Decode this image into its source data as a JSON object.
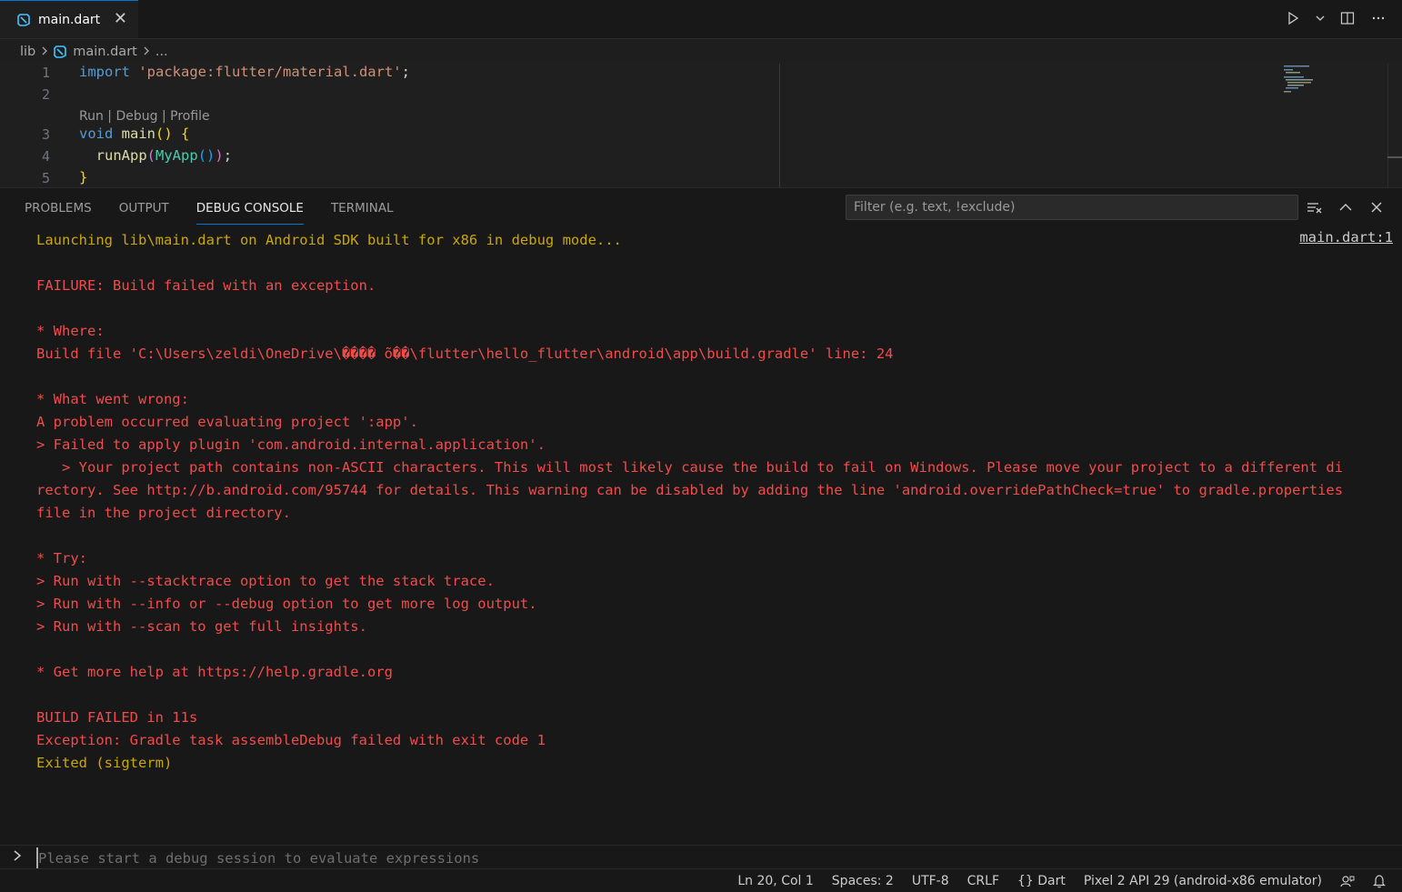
{
  "tab": {
    "label": "main.dart",
    "close": "✕"
  },
  "breadcrumb": {
    "folder": "lib",
    "file": "main.dart",
    "more": "..."
  },
  "editor": {
    "line_numbers": [
      "1",
      "2",
      "3",
      "4",
      "5"
    ],
    "codelens": "Run | Debug | Profile",
    "code": {
      "l1_kw": "import",
      "l1_str": "'package:flutter/material.dart'",
      "l1_end": ";",
      "l3_kw": "void",
      "l3_fn": "main",
      "l3_parens": "()",
      "l3_brace": "{",
      "l4_fn": "runApp",
      "l4_open": "(",
      "l4_cls": "MyApp",
      "l4_call": "()",
      "l4_close": ")",
      "l4_end": ";",
      "l5_brace": "}"
    }
  },
  "panel": {
    "tabs": [
      "PROBLEMS",
      "OUTPUT",
      "DEBUG CONSOLE",
      "TERMINAL"
    ],
    "active_tab": "DEBUG CONSOLE",
    "filter_placeholder": "Filter (e.g. text, !exclude)",
    "source_link": "main.dart:1",
    "console_lines": [
      {
        "text": "Launching lib\\main.dart on Android SDK built for x86 in debug mode...",
        "color": "yellow"
      },
      {
        "text": "",
        "color": "red"
      },
      {
        "text": "FAILURE: Build failed with an exception.",
        "color": "red"
      },
      {
        "text": "",
        "color": "red"
      },
      {
        "text": "* Where:",
        "color": "red"
      },
      {
        "text": "Build file 'C:\\Users\\zeldi\\OneDrive\\���� õ��\\flutter\\hello_flutter\\android\\app\\build.gradle' line: 24",
        "color": "red"
      },
      {
        "text": "",
        "color": "red"
      },
      {
        "text": "* What went wrong:",
        "color": "red"
      },
      {
        "text": "A problem occurred evaluating project ':app'.",
        "color": "red"
      },
      {
        "text": "> Failed to apply plugin 'com.android.internal.application'.",
        "color": "red"
      },
      {
        "text": "   > Your project path contains non-ASCII characters. This will most likely cause the build to fail on Windows. Please move your project to a different di",
        "color": "red"
      },
      {
        "text": "rectory. See http://b.android.com/95744 for details. This warning can be disabled by adding the line 'android.overridePathCheck=true' to gradle.properties",
        "color": "red"
      },
      {
        "text": "file in the project directory.",
        "color": "red"
      },
      {
        "text": "",
        "color": "red"
      },
      {
        "text": "* Try:",
        "color": "red"
      },
      {
        "text": "> Run with --stacktrace option to get the stack trace.",
        "color": "red"
      },
      {
        "text": "> Run with --info or --debug option to get more log output.",
        "color": "red"
      },
      {
        "text": "> Run with --scan to get full insights.",
        "color": "red"
      },
      {
        "text": "",
        "color": "red"
      },
      {
        "text": "* Get more help at https://help.gradle.org",
        "color": "red"
      },
      {
        "text": "",
        "color": "red"
      },
      {
        "text": "BUILD FAILED in 11s",
        "color": "red"
      },
      {
        "text": "Exception: Gradle task assembleDebug failed with exit code 1",
        "color": "red"
      },
      {
        "text": "Exited (sigterm)",
        "color": "yellow"
      }
    ],
    "repl_placeholder": "Please start a debug session to evaluate expressions"
  },
  "status": {
    "position": "Ln 20, Col 1",
    "spaces": "Spaces: 2",
    "encoding": "UTF-8",
    "eol": "CRLF",
    "language": "{} Dart",
    "device": "Pixel 2 API 29 (android-x86 emulator)"
  },
  "colors": {
    "accent": "#0078d4",
    "error": "#f14c4c",
    "warning": "#cca700",
    "dart_blue": "#40c4ff"
  }
}
